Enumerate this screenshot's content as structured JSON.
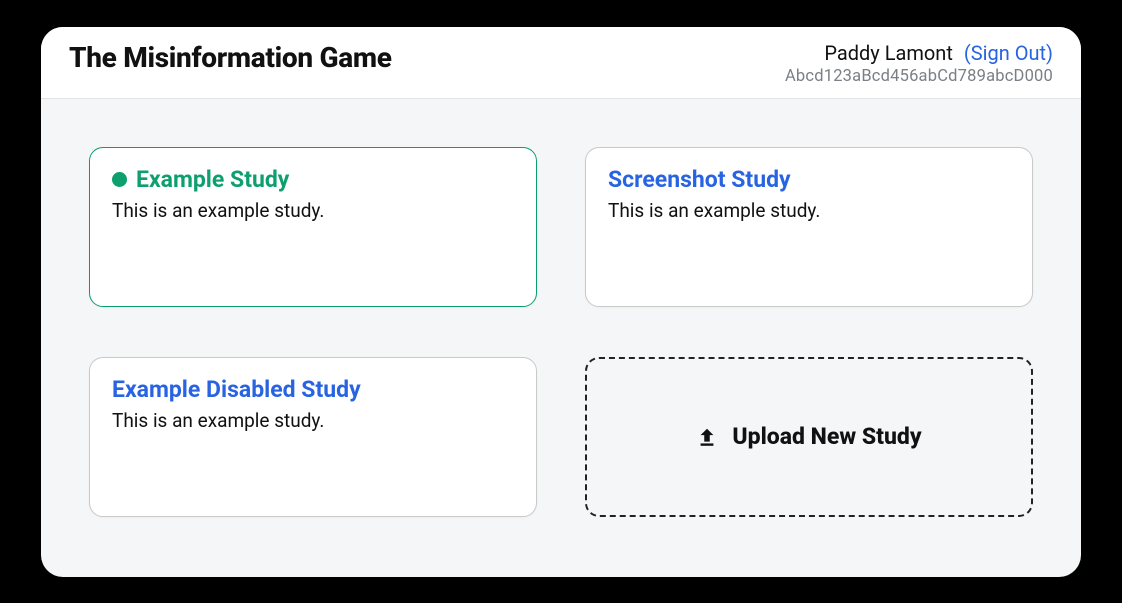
{
  "header": {
    "app_title": "The Misinformation Game",
    "user_name": "Paddy Lamont",
    "sign_out_label": "(Sign Out)",
    "user_id": "Abcd123aBcd456abCd789abcD000"
  },
  "studies": [
    {
      "title": "Example Study",
      "description": "This is an example study.",
      "active": true
    },
    {
      "title": "Screenshot Study",
      "description": "This is an example study.",
      "active": false
    },
    {
      "title": "Example Disabled Study",
      "description": "This is an example study.",
      "active": false
    }
  ],
  "upload": {
    "label": "Upload New Study"
  },
  "colors": {
    "link": "#2863e2",
    "active": "#0e9f6e"
  }
}
